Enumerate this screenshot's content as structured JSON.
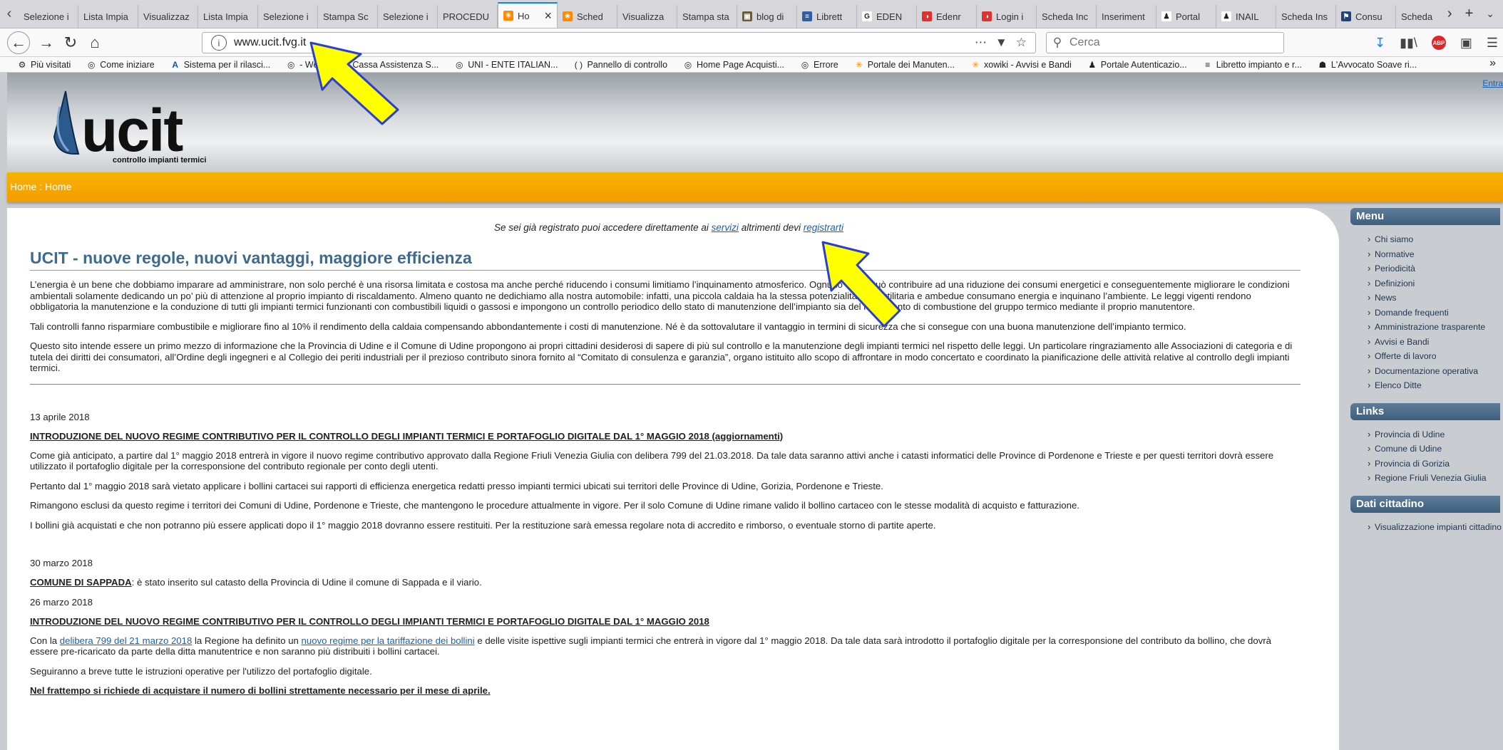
{
  "browser": {
    "tabs": [
      {
        "label": "Selezione i",
        "icon": "none"
      },
      {
        "label": "Lista Impia",
        "icon": "none"
      },
      {
        "label": "Visualizzaz",
        "icon": "none"
      },
      {
        "label": "Lista Impia",
        "icon": "none"
      },
      {
        "label": "Selezione i",
        "icon": "none"
      },
      {
        "label": "Stampa Sc",
        "icon": "none"
      },
      {
        "label": "Selezione i",
        "icon": "none"
      },
      {
        "label": "PROCEDU",
        "icon": "none"
      },
      {
        "label": "Ho",
        "icon": "orange-logo-icon",
        "active": true
      },
      {
        "label": "Sched",
        "icon": "orange-logo-icon"
      },
      {
        "label": "Visualizza",
        "icon": "none"
      },
      {
        "label": "Stampa sta",
        "icon": "none"
      },
      {
        "label": "blog di",
        "icon": "image-icon"
      },
      {
        "label": "Librett",
        "icon": "doc-icon"
      },
      {
        "label": "EDEN",
        "icon": "google-icon"
      },
      {
        "label": "Edenr",
        "icon": "red-circle-icon"
      },
      {
        "label": "Login i",
        "icon": "red-circle-icon"
      },
      {
        "label": "Scheda Inc",
        "icon": "none"
      },
      {
        "label": "Inseriment",
        "icon": "none"
      },
      {
        "label": "Portal",
        "icon": "person-icon"
      },
      {
        "label": "INAIL",
        "icon": "person-icon"
      },
      {
        "label": "Scheda Ins",
        "icon": "none"
      },
      {
        "label": "Consu",
        "icon": "flag-icon"
      },
      {
        "label": "Scheda",
        "icon": "none"
      }
    ],
    "url": "www.ucit.fvg.it",
    "search_placeholder": "Cerca",
    "bookmarks": [
      {
        "label": "Più visitati",
        "icon": "gear-icon"
      },
      {
        "label": "Come iniziare",
        "icon": "globe-icon"
      },
      {
        "label": "Sistema per il rilasci...",
        "icon": "a-icon"
      },
      {
        "label": "- Web",
        "icon": "globe-icon"
      },
      {
        "label": "Cassa Assistenza S...",
        "icon": "globe-icon"
      },
      {
        "label": "UNI - ENTE ITALIAN...",
        "icon": "globe-icon"
      },
      {
        "label": "Pannello di controllo",
        "icon": "parens-icon"
      },
      {
        "label": "Home Page Acquisti...",
        "icon": "globe-icon"
      },
      {
        "label": "Errore",
        "icon": "globe-icon"
      },
      {
        "label": "Portale dei Manuten...",
        "icon": "orange-logo-icon"
      },
      {
        "label": "xowiki - Avvisi e Bandi",
        "icon": "orange-logo-icon"
      },
      {
        "label": "Portale Autenticazio...",
        "icon": "person-icon"
      },
      {
        "label": "Libretto impianto e r...",
        "icon": "doc-icon"
      },
      {
        "label": "L'Avvocato Soave ri...",
        "icon": "building-icon"
      }
    ]
  },
  "header": {
    "logo_text": "ucit",
    "logo_subtitle": "controllo impianti termici",
    "enter_link": "Entra"
  },
  "breadcrumb": {
    "home": "Home",
    "sep": " : ",
    "current": "Home"
  },
  "notice": {
    "before": "Se sei già registrato puoi accedere direttamente ai ",
    "link1": "servizi",
    "middle": " altrimenti devi ",
    "link2": "registrarti"
  },
  "main": {
    "title": "UCIT - nuove regole, nuovi vantaggi, maggiore efficienza",
    "intro": [
      "L’energia è un bene che dobbiamo imparare ad amministrare, non solo perché è una risorsa limitata e costosa ma anche perché riducendo i consumi limitiamo l’inquinamento atmosferico. Ognuno di noi può contribuire ad una riduzione dei consumi energetici e conseguentemente migliorare le condizioni ambientali solamente dedicando un po’ più di attenzione al proprio impianto di riscaldamento. Almeno quanto ne dedichiamo alla nostra automobile: infatti, una piccola caldaia ha la stessa potenzialità di un’utilitaria e ambedue consumano energia e inquinano l’ambiente. Le leggi vigenti rendono obbligatoria la manutenzione e la conduzione di tutti gli impianti termici funzionanti con combustibili liquidi o gassosi e impongono un controllo periodico dello stato di manutenzione dell’impianto sia del rendimento di combustione del gruppo termico mediante il proprio manutentore.",
      "Tali controlli fanno risparmiare combustibile e migliorare fino al 10% il rendimento della caldaia compensando abbondantemente i costi di manutenzione. Né è da sottovalutare il vantaggio in termini di sicurezza che si consegue con una buona manutenzione dell’impianto termico.",
      "Questo sito intende essere un primo mezzo di informazione che la Provincia di Udine e il Comune di Udine propongono ai propri cittadini desiderosi di sapere di più sul controllo e la manutenzione degli impianti termici nel rispetto delle leggi. Un particolare ringraziamento alle Associazioni di categoria e di tutela dei diritti dei consumatori, all’Ordine degli ingegneri e al Collegio dei periti industriali per il prezioso contributo sinora fornito al “Comitato di consulenza e garanzia”, organo istituito allo scopo di affrontare in modo concertato e coordinato la pianificazione delle attività relative al controllo degli impianti termici."
    ]
  },
  "news": {
    "n1": {
      "date": "13 aprile 2018",
      "headline": "INTRODUZIONE DEL NUOVO REGIME CONTRIBUTIVO PER IL CONTROLLO DEGLI IMPIANTI TERMICI E PORTAFOGLIO DIGITALE DAL 1° MAGGIO 2018 (aggiornamenti)",
      "paras": [
        "Come già anticipato, a partire dal 1° maggio 2018 entrerà in vigore il nuovo regime contributivo approvato dalla Regione Friuli Venezia Giulia con delibera 799 del 21.03.2018. Da tale data saranno attivi anche i catasti informatici delle Province di Pordenone e Trieste e per questi territori dovrà  essere utilizzato il portafoglio digitale per la corresponsione del contributo regionale per conto degli utenti.",
        "Pertanto dal 1° maggio 2018 sarà vietato applicare i bollini cartacei sui rapporti di efficienza energetica redatti presso impianti termici ubicati sui territori delle Province di Udine, Gorizia, Pordenone e Trieste.",
        "Rimangono esclusi da questo regime i territori dei Comuni di Udine, Pordenone e Trieste, che mantengono le procedure attualmente in vigore. Per il solo Comune di Udine rimane valido il bollino cartaceo con le stesse modalità di acquisto e fatturazione.",
        "I bollini già acquistati e che non potranno più essere applicati dopo il 1° maggio 2018 dovranno essere restituiti. Per la restituzione sarà emessa regolare nota di accredito e rimborso, o eventuale storno di partite aperte."
      ]
    },
    "n2": {
      "date": "30 marzo 2018",
      "label": "COMUNE DI SAPPADA",
      "text": ": è stato inserito sul catasto della Provincia di Udine  il comune di Sappada e il viario."
    },
    "n3": {
      "date": "26 marzo 2018",
      "headline": "INTRODUZIONE DEL NUOVO REGIME CONTRIBUTIVO PER IL CONTROLLO DEGLI IMPIANTI TERMICI E PORTAFOGLIO DIGITALE DAL 1° MAGGIO 2018",
      "p1_a": "Con la ",
      "p1_link1": "delibera 799 del 21 marzo 2018",
      "p1_b": " la Regione ha definito un ",
      "p1_link2": "nuovo regime per la tariffazione dei bollini",
      "p1_c": " e delle visite ispettive sugli impianti termici che entrerà in vigore dal 1° maggio 2018. Da tale data sarà introdotto il portafoglio digitale per la corresponsione del contributo da bollino, che dovrà essere pre-ricaricato da parte della ditta manutentrice e non saranno più distribuiti i bollini cartacei.",
      "p2": "Seguiranno a breve tutte le istruzioni operative per l'utilizzo del portafoglio digitale.",
      "p3": "Nel frattempo si richiede di acquistare il numero di bollini strettamente necessario per il mese di aprile."
    }
  },
  "sidebar": {
    "menu_title": "Menu",
    "menu_items": [
      "Chi siamo",
      "Normative",
      "Periodicità",
      "Definizioni",
      "News",
      "Domande frequenti",
      "Amministrazione trasparente",
      "Avvisi e Bandi",
      "Offerte di lavoro",
      "Documentazione operativa",
      "Elenco Ditte"
    ],
    "links_title": "Links",
    "links_items": [
      "Provincia di Udine",
      "Comune di Udine",
      "Provincia di Gorizia",
      "Regione Friuli Venezia Giulia"
    ],
    "cittadino_title": "Dati cittadino",
    "cittadino_items": [
      "Visualizzazione impianti cittadino"
    ]
  },
  "colors": {
    "accent_orange": "#f5a800",
    "title_blue": "#3d6a8e",
    "arrow_yellow": "#ffff00",
    "arrow_border": "#2a3fd0"
  }
}
